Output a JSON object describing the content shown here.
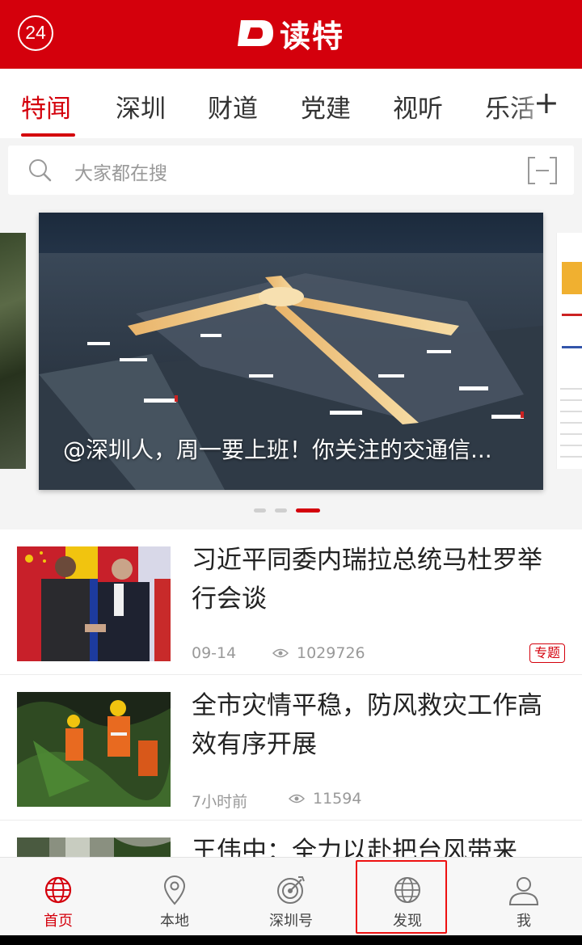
{
  "header": {
    "badge": "24",
    "logo_text": "读特"
  },
  "tabs": [
    {
      "label": "特闻",
      "active": true
    },
    {
      "label": "深圳",
      "active": false
    },
    {
      "label": "财道",
      "active": false
    },
    {
      "label": "党建",
      "active": false
    },
    {
      "label": "视听",
      "active": false
    },
    {
      "label": "乐活",
      "active": false
    }
  ],
  "tabs_add": "+",
  "search": {
    "placeholder": "大家都在搜"
  },
  "carousel": {
    "caption": "@深圳人，周一要上班！你关注的交通信...",
    "dots": 3,
    "active_dot": 3
  },
  "news": [
    {
      "title": "习近平同委内瑞拉总统马杜罗举行会谈",
      "date": "09-14",
      "views": "1029726",
      "tag": "专题"
    },
    {
      "title": "全市灾情平稳，防风救灾工作高效有序开展",
      "date": "7小时前",
      "views": "11594",
      "tag": ""
    },
    {
      "title": "王伟中：全力以赴把台风带来",
      "date": "",
      "views": "",
      "tag": ""
    }
  ],
  "bottom_nav": [
    {
      "label": "首页",
      "icon": "globe-icon",
      "active": true
    },
    {
      "label": "本地",
      "icon": "location-pin-icon",
      "active": false
    },
    {
      "label": "深圳号",
      "icon": "target-icon",
      "active": false
    },
    {
      "label": "发现",
      "icon": "globe-icon",
      "active": false
    },
    {
      "label": "我",
      "icon": "user-icon",
      "active": false
    }
  ],
  "colors": {
    "brand": "#d4000c",
    "highlight": "#ee1111"
  }
}
